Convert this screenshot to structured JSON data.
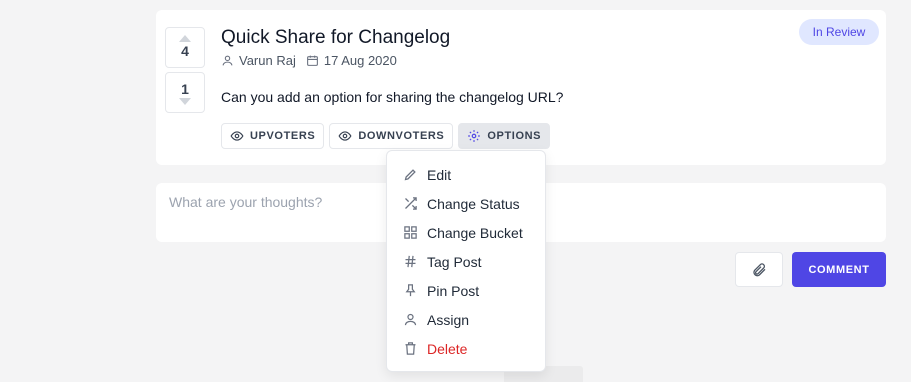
{
  "post": {
    "title": "Quick Share for Changelog",
    "author": "Varun Raj",
    "date": "17 Aug 2020",
    "status": "In Review",
    "body": "Can you add an option for sharing the changelog URL?",
    "upvotes": "4",
    "downvotes": "1"
  },
  "actions": {
    "upvoters_label": "UPVOTERS",
    "downvoters_label": "DOWNVOTERS",
    "options_label": "OPTIONS"
  },
  "menu": {
    "items": [
      {
        "label": "Edit",
        "icon": "pencil-icon"
      },
      {
        "label": "Change Status",
        "icon": "shuffle-icon"
      },
      {
        "label": "Change Bucket",
        "icon": "grid-icon"
      },
      {
        "label": "Tag Post",
        "icon": "hash-icon"
      },
      {
        "label": "Pin Post",
        "icon": "pin-icon"
      },
      {
        "label": "Assign",
        "icon": "user-icon"
      },
      {
        "label": "Delete",
        "icon": "trash-icon",
        "color": "#dc2626"
      }
    ]
  },
  "comment": {
    "placeholder": "What are your thoughts?",
    "value": "",
    "submit_label": "COMMENT",
    "attach_icon": "paperclip-icon"
  },
  "colors": {
    "accent": "#4f46e5",
    "status_bg": "#e0e7ff",
    "danger": "#dc2626"
  }
}
